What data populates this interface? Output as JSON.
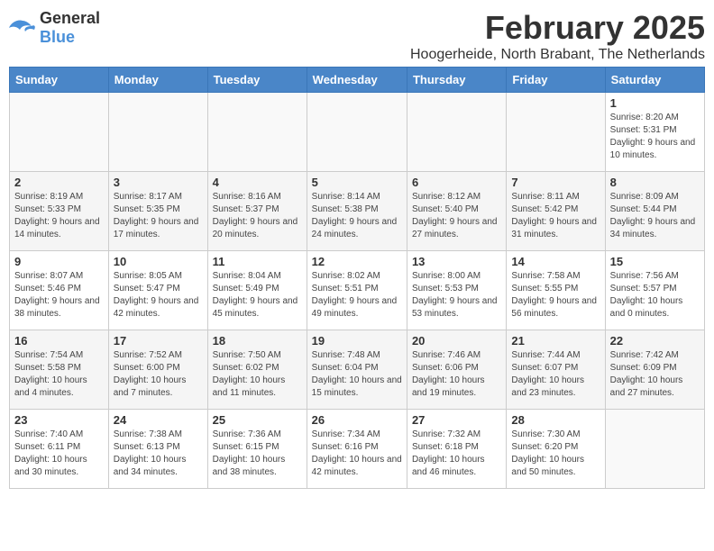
{
  "logo": {
    "general": "General",
    "blue": "Blue"
  },
  "title": "February 2025",
  "location": "Hoogerheide, North Brabant, The Netherlands",
  "weekdays": [
    "Sunday",
    "Monday",
    "Tuesday",
    "Wednesday",
    "Thursday",
    "Friday",
    "Saturday"
  ],
  "weeks": [
    [
      {
        "day": "",
        "info": ""
      },
      {
        "day": "",
        "info": ""
      },
      {
        "day": "",
        "info": ""
      },
      {
        "day": "",
        "info": ""
      },
      {
        "day": "",
        "info": ""
      },
      {
        "day": "",
        "info": ""
      },
      {
        "day": "1",
        "info": "Sunrise: 8:20 AM\nSunset: 5:31 PM\nDaylight: 9 hours and 10 minutes."
      }
    ],
    [
      {
        "day": "2",
        "info": "Sunrise: 8:19 AM\nSunset: 5:33 PM\nDaylight: 9 hours and 14 minutes."
      },
      {
        "day": "3",
        "info": "Sunrise: 8:17 AM\nSunset: 5:35 PM\nDaylight: 9 hours and 17 minutes."
      },
      {
        "day": "4",
        "info": "Sunrise: 8:16 AM\nSunset: 5:37 PM\nDaylight: 9 hours and 20 minutes."
      },
      {
        "day": "5",
        "info": "Sunrise: 8:14 AM\nSunset: 5:38 PM\nDaylight: 9 hours and 24 minutes."
      },
      {
        "day": "6",
        "info": "Sunrise: 8:12 AM\nSunset: 5:40 PM\nDaylight: 9 hours and 27 minutes."
      },
      {
        "day": "7",
        "info": "Sunrise: 8:11 AM\nSunset: 5:42 PM\nDaylight: 9 hours and 31 minutes."
      },
      {
        "day": "8",
        "info": "Sunrise: 8:09 AM\nSunset: 5:44 PM\nDaylight: 9 hours and 34 minutes."
      }
    ],
    [
      {
        "day": "9",
        "info": "Sunrise: 8:07 AM\nSunset: 5:46 PM\nDaylight: 9 hours and 38 minutes."
      },
      {
        "day": "10",
        "info": "Sunrise: 8:05 AM\nSunset: 5:47 PM\nDaylight: 9 hours and 42 minutes."
      },
      {
        "day": "11",
        "info": "Sunrise: 8:04 AM\nSunset: 5:49 PM\nDaylight: 9 hours and 45 minutes."
      },
      {
        "day": "12",
        "info": "Sunrise: 8:02 AM\nSunset: 5:51 PM\nDaylight: 9 hours and 49 minutes."
      },
      {
        "day": "13",
        "info": "Sunrise: 8:00 AM\nSunset: 5:53 PM\nDaylight: 9 hours and 53 minutes."
      },
      {
        "day": "14",
        "info": "Sunrise: 7:58 AM\nSunset: 5:55 PM\nDaylight: 9 hours and 56 minutes."
      },
      {
        "day": "15",
        "info": "Sunrise: 7:56 AM\nSunset: 5:57 PM\nDaylight: 10 hours and 0 minutes."
      }
    ],
    [
      {
        "day": "16",
        "info": "Sunrise: 7:54 AM\nSunset: 5:58 PM\nDaylight: 10 hours and 4 minutes."
      },
      {
        "day": "17",
        "info": "Sunrise: 7:52 AM\nSunset: 6:00 PM\nDaylight: 10 hours and 7 minutes."
      },
      {
        "day": "18",
        "info": "Sunrise: 7:50 AM\nSunset: 6:02 PM\nDaylight: 10 hours and 11 minutes."
      },
      {
        "day": "19",
        "info": "Sunrise: 7:48 AM\nSunset: 6:04 PM\nDaylight: 10 hours and 15 minutes."
      },
      {
        "day": "20",
        "info": "Sunrise: 7:46 AM\nSunset: 6:06 PM\nDaylight: 10 hours and 19 minutes."
      },
      {
        "day": "21",
        "info": "Sunrise: 7:44 AM\nSunset: 6:07 PM\nDaylight: 10 hours and 23 minutes."
      },
      {
        "day": "22",
        "info": "Sunrise: 7:42 AM\nSunset: 6:09 PM\nDaylight: 10 hours and 27 minutes."
      }
    ],
    [
      {
        "day": "23",
        "info": "Sunrise: 7:40 AM\nSunset: 6:11 PM\nDaylight: 10 hours and 30 minutes."
      },
      {
        "day": "24",
        "info": "Sunrise: 7:38 AM\nSunset: 6:13 PM\nDaylight: 10 hours and 34 minutes."
      },
      {
        "day": "25",
        "info": "Sunrise: 7:36 AM\nSunset: 6:15 PM\nDaylight: 10 hours and 38 minutes."
      },
      {
        "day": "26",
        "info": "Sunrise: 7:34 AM\nSunset: 6:16 PM\nDaylight: 10 hours and 42 minutes."
      },
      {
        "day": "27",
        "info": "Sunrise: 7:32 AM\nSunset: 6:18 PM\nDaylight: 10 hours and 46 minutes."
      },
      {
        "day": "28",
        "info": "Sunrise: 7:30 AM\nSunset: 6:20 PM\nDaylight: 10 hours and 50 minutes."
      },
      {
        "day": "",
        "info": ""
      }
    ]
  ]
}
